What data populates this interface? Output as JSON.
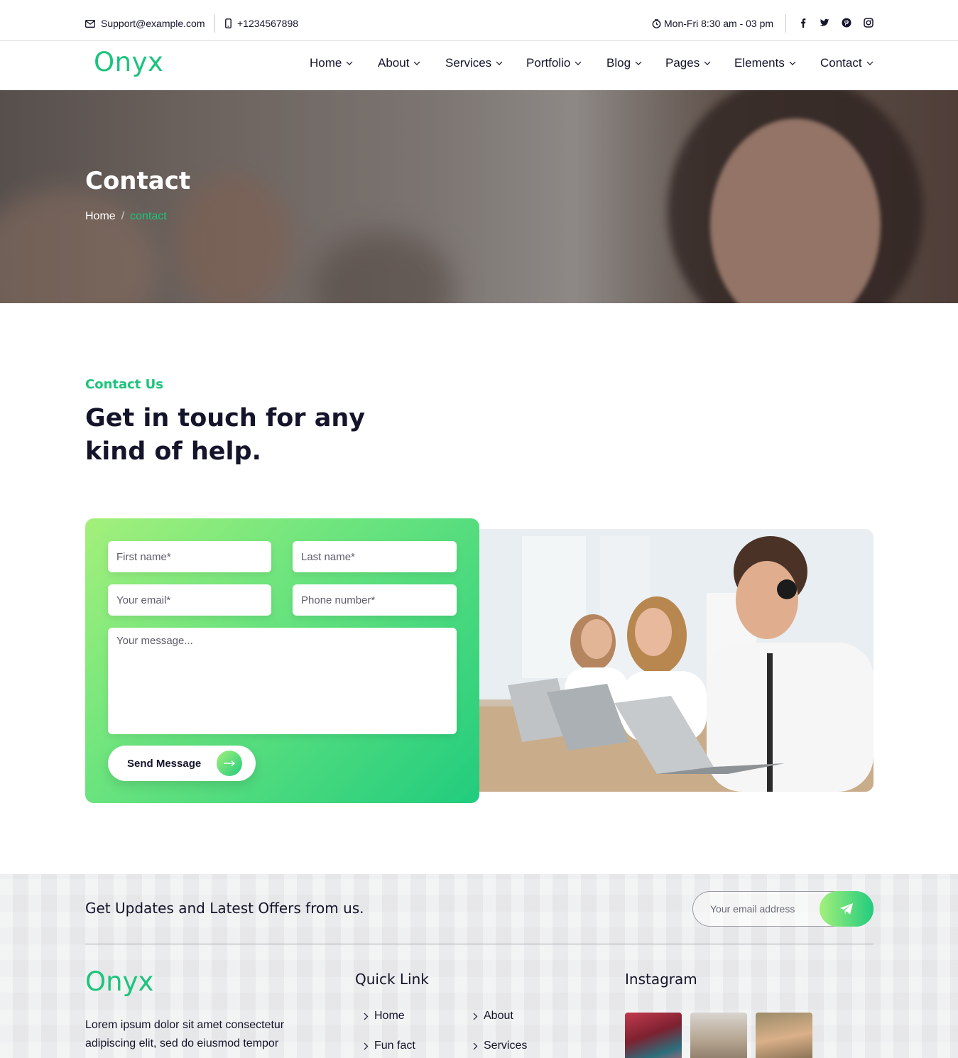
{
  "topbar": {
    "email": "Support@example.com",
    "phone": "+1234567898",
    "hours": "Mon-Fri 8:30 am - 03 pm",
    "social_icons": [
      "facebook-icon",
      "twitter-icon",
      "pinterest-icon",
      "instagram-icon"
    ]
  },
  "brand": {
    "name": "Onyx",
    "accent_color": "#1cc47c",
    "text_color": "#14142b"
  },
  "nav": {
    "items": [
      {
        "label": "Home"
      },
      {
        "label": "About"
      },
      {
        "label": "Services"
      },
      {
        "label": "Portfolio"
      },
      {
        "label": "Blog"
      },
      {
        "label": "Pages"
      },
      {
        "label": "Elements"
      },
      {
        "label": "Contact"
      }
    ]
  },
  "hero": {
    "title": "Contact",
    "breadcrumb": {
      "home": "Home",
      "separator": "/",
      "current": "contact"
    }
  },
  "section": {
    "eyebrow": "Contact Us",
    "headline": "Get in touch for any kind of help."
  },
  "form": {
    "first_name_placeholder": "First name*",
    "last_name_placeholder": "Last name*",
    "email_placeholder": "Your email*",
    "phone_placeholder": "Phone number*",
    "message_placeholder": "Your message...",
    "submit_label": "Send Message"
  },
  "footer": {
    "newsletter_title": "Get Updates and Latest Offers from us.",
    "newsletter_placeholder": "Your email address",
    "logo": "Onyx",
    "about_text": "Lorem ipsum dolor sit amet consectetur adipiscing elit, sed do eiusmod tempor",
    "quick_link_title": "Quick Link",
    "quick_links": [
      {
        "label": "Home"
      },
      {
        "label": "About"
      },
      {
        "label": "Fun fact"
      },
      {
        "label": "Services"
      }
    ],
    "instagram_title": "Instagram"
  }
}
